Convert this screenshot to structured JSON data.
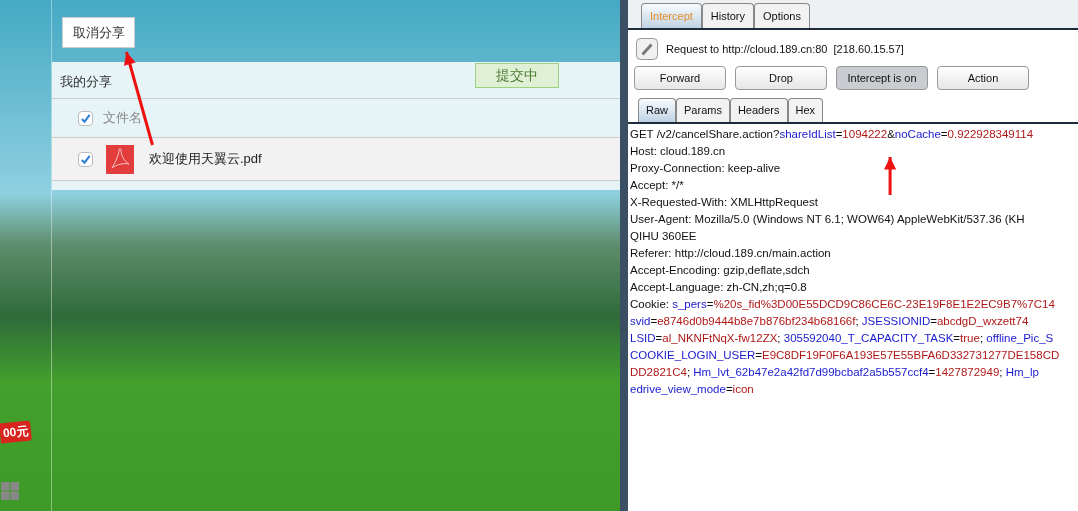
{
  "left_page": {
    "cancel_button": "取消分享",
    "section_title": "我的分享",
    "status_badge": "提交中",
    "header": {
      "checked": true,
      "label": "文件名"
    },
    "files": [
      {
        "checked": true,
        "name": "欢迎使用天翼云.pdf"
      }
    ],
    "promo_badge": "00元"
  },
  "proxy": {
    "tabs": [
      {
        "label": "Intercept",
        "selected": true
      },
      {
        "label": "History",
        "selected": false
      },
      {
        "label": "Options",
        "selected": false
      }
    ],
    "request_info": "Request to http://cloud.189.cn:80  [218.60.15.57]",
    "buttons": [
      {
        "label": "Forward",
        "on": false
      },
      {
        "label": "Drop",
        "on": false
      },
      {
        "label": "Intercept is on",
        "on": true
      },
      {
        "label": "Action",
        "on": false
      }
    ],
    "view_tabs": [
      {
        "label": "Raw",
        "selected": true
      },
      {
        "label": "Params",
        "selected": false
      },
      {
        "label": "Headers",
        "selected": false
      },
      {
        "label": "Hex",
        "selected": false
      }
    ],
    "request_lines": [
      [
        {
          "kind": "text",
          "text": "GET /v2/cancelShare.action?"
        },
        {
          "kind": "param",
          "text": "shareIdList"
        },
        {
          "kind": "text",
          "text": "="
        },
        {
          "kind": "value",
          "text": "1094222"
        },
        {
          "kind": "text",
          "text": "&"
        },
        {
          "kind": "param",
          "text": "noCache"
        },
        {
          "kind": "text",
          "text": "="
        },
        {
          "kind": "value",
          "text": "0.922928349114"
        }
      ],
      [
        {
          "kind": "text",
          "text": "Host: cloud.189.cn"
        }
      ],
      [
        {
          "kind": "text",
          "text": "Proxy-Connection: keep-alive"
        }
      ],
      [
        {
          "kind": "text",
          "text": "Accept: */*"
        }
      ],
      [
        {
          "kind": "text",
          "text": "X-Requested-With: XMLHttpRequest"
        }
      ],
      [
        {
          "kind": "text",
          "text": "User-Agent: Mozilla/5.0 (Windows NT 6.1; WOW64) AppleWebKit/537.36 (KH"
        }
      ],
      [
        {
          "kind": "text",
          "text": "QIHU 360EE"
        }
      ],
      [
        {
          "kind": "text",
          "text": "Referer: http://cloud.189.cn/main.action"
        }
      ],
      [
        {
          "kind": "text",
          "text": "Accept-Encoding: gzip,deflate,sdch"
        }
      ],
      [
        {
          "kind": "text",
          "text": "Accept-Language: zh-CN,zh;q=0.8"
        }
      ],
      [
        {
          "kind": "text",
          "text": "Cookie: "
        },
        {
          "kind": "param",
          "text": "s_pers"
        },
        {
          "kind": "text",
          "text": "="
        },
        {
          "kind": "value",
          "text": "%20s_fid%3D00E55DCD9C86CE6C-23E19F8E1E2EC9B7%7C14"
        }
      ],
      [
        {
          "kind": "param",
          "text": "svid"
        },
        {
          "kind": "text",
          "text": "="
        },
        {
          "kind": "value",
          "text": "e8746d0b9444b8e7b876bf234b68166f"
        },
        {
          "kind": "text",
          "text": "; "
        },
        {
          "kind": "param",
          "text": "JSESSIONID"
        },
        {
          "kind": "text",
          "text": "="
        },
        {
          "kind": "value",
          "text": "abcdgD_wxzett74"
        }
      ],
      [
        {
          "kind": "param",
          "text": "LSID"
        },
        {
          "kind": "text",
          "text": "="
        },
        {
          "kind": "value",
          "text": "al_NKNFtNqX-fw12ZX"
        },
        {
          "kind": "text",
          "text": "; "
        },
        {
          "kind": "param",
          "text": "305592040_T_CAPACITY_TASK"
        },
        {
          "kind": "text",
          "text": "="
        },
        {
          "kind": "value",
          "text": "true"
        },
        {
          "kind": "text",
          "text": "; "
        },
        {
          "kind": "param",
          "text": "offline_Pic_S"
        }
      ],
      [
        {
          "kind": "param",
          "text": "COOKIE_LOGIN_USER"
        },
        {
          "kind": "text",
          "text": "="
        },
        {
          "kind": "value",
          "text": "E9C8DF19F0F6A193E57E55BFA6D332731277DE158CD"
        }
      ],
      [
        {
          "kind": "value",
          "text": "DD2821C4"
        },
        {
          "kind": "text",
          "text": "; "
        },
        {
          "kind": "param",
          "text": "Hm_lvt_62b47e2a42fd7d99bcbaf2a5b557ccf4"
        },
        {
          "kind": "text",
          "text": "="
        },
        {
          "kind": "value",
          "text": "1427872949"
        },
        {
          "kind": "text",
          "text": "; "
        },
        {
          "kind": "param",
          "text": "Hm_lp"
        }
      ],
      [
        {
          "kind": "param",
          "text": "edrive_view_mode"
        },
        {
          "kind": "text",
          "text": "="
        },
        {
          "kind": "value",
          "text": "icon"
        }
      ]
    ]
  }
}
